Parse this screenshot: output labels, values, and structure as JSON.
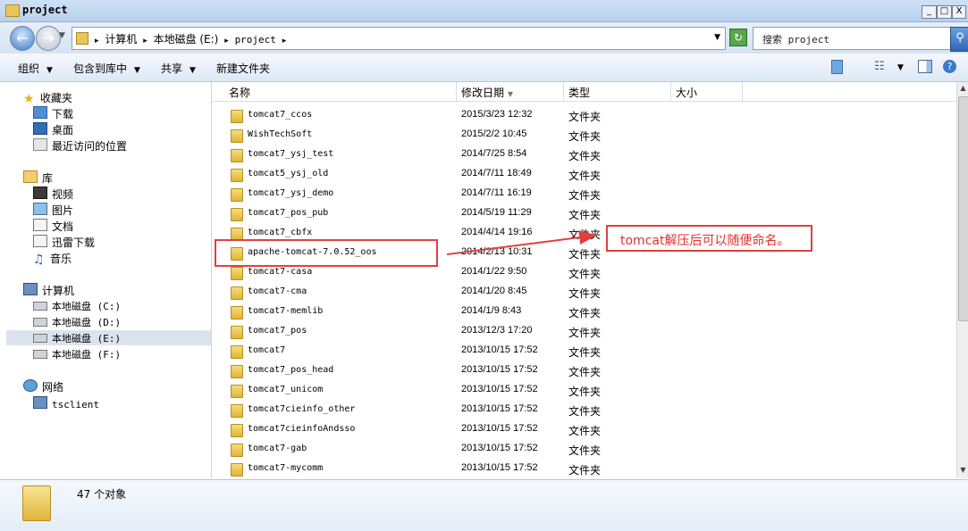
{
  "window": {
    "title": "project",
    "minimize": "_",
    "maximize": "□",
    "close": "X"
  },
  "address": {
    "crumbs": [
      "计算机",
      "本地磁盘 (E:)",
      "project"
    ],
    "search_placeholder": "搜索 project"
  },
  "toolbar": {
    "organize": "组织",
    "include_in_library": "包含到库中",
    "share": "共享",
    "new_folder": "新建文件夹"
  },
  "sidebar": {
    "favorites": "收藏夹",
    "favorites_items": [
      "下载",
      "桌面",
      "最近访问的位置"
    ],
    "libraries": "库",
    "library_items": [
      "视频",
      "图片",
      "文档",
      "迅雷下载",
      "音乐"
    ],
    "computer": "计算机",
    "drives": [
      "本地磁盘 (C:)",
      "本地磁盘 (D:)",
      "本地磁盘 (E:)",
      "本地磁盘 (F:)"
    ],
    "network": "网络",
    "network_items": [
      "tsclient"
    ]
  },
  "columns": {
    "name": "名称",
    "modified": "修改日期",
    "type": "类型",
    "size": "大小"
  },
  "files": [
    {
      "name": "tomcat7_ccos",
      "date": "2015/3/23 12:32",
      "type": "文件夹"
    },
    {
      "name": "WishTechSoft",
      "date": "2015/2/2 10:45",
      "type": "文件夹"
    },
    {
      "name": "tomcat7_ysj_test",
      "date": "2014/7/25 8:54",
      "type": "文件夹"
    },
    {
      "name": "tomcat5_ysj_old",
      "date": "2014/7/11 18:49",
      "type": "文件夹"
    },
    {
      "name": "tomcat7_ysj_demo",
      "date": "2014/7/11 16:19",
      "type": "文件夹"
    },
    {
      "name": "tomcat7_pos_pub",
      "date": "2014/5/19 11:29",
      "type": "文件夹"
    },
    {
      "name": "tomcat7_cbfx",
      "date": "2014/4/14 19:16",
      "type": "文件夹"
    },
    {
      "name": "apache-tomcat-7.0.52_oos",
      "date": "2014/2/13 10:31",
      "type": "文件夹"
    },
    {
      "name": "tomcat7-casa",
      "date": "2014/1/22 9:50",
      "type": "文件夹"
    },
    {
      "name": "tomcat7-cma",
      "date": "2014/1/20 8:45",
      "type": "文件夹"
    },
    {
      "name": "tomcat7-memlib",
      "date": "2014/1/9 8:43",
      "type": "文件夹"
    },
    {
      "name": "tomcat7_pos",
      "date": "2013/12/3 17:20",
      "type": "文件夹"
    },
    {
      "name": "tomcat7",
      "date": "2013/10/15 17:52",
      "type": "文件夹"
    },
    {
      "name": "tomcat7_pos_head",
      "date": "2013/10/15 17:52",
      "type": "文件夹"
    },
    {
      "name": "tomcat7_unicom",
      "date": "2013/10/15 17:52",
      "type": "文件夹"
    },
    {
      "name": "tomcat7cieinfo_other",
      "date": "2013/10/15 17:52",
      "type": "文件夹"
    },
    {
      "name": "tomcat7cieinfoAndsso",
      "date": "2013/10/15 17:52",
      "type": "文件夹"
    },
    {
      "name": "tomcat7-gab",
      "date": "2013/10/15 17:52",
      "type": "文件夹"
    },
    {
      "name": "tomcat7-mycomm",
      "date": "2013/10/15 17:52",
      "type": "文件夹"
    }
  ],
  "status": {
    "count": "47 个对象"
  },
  "annotation": {
    "text": "tomcat解压后可以随便命名。",
    "color": "#e03030"
  }
}
